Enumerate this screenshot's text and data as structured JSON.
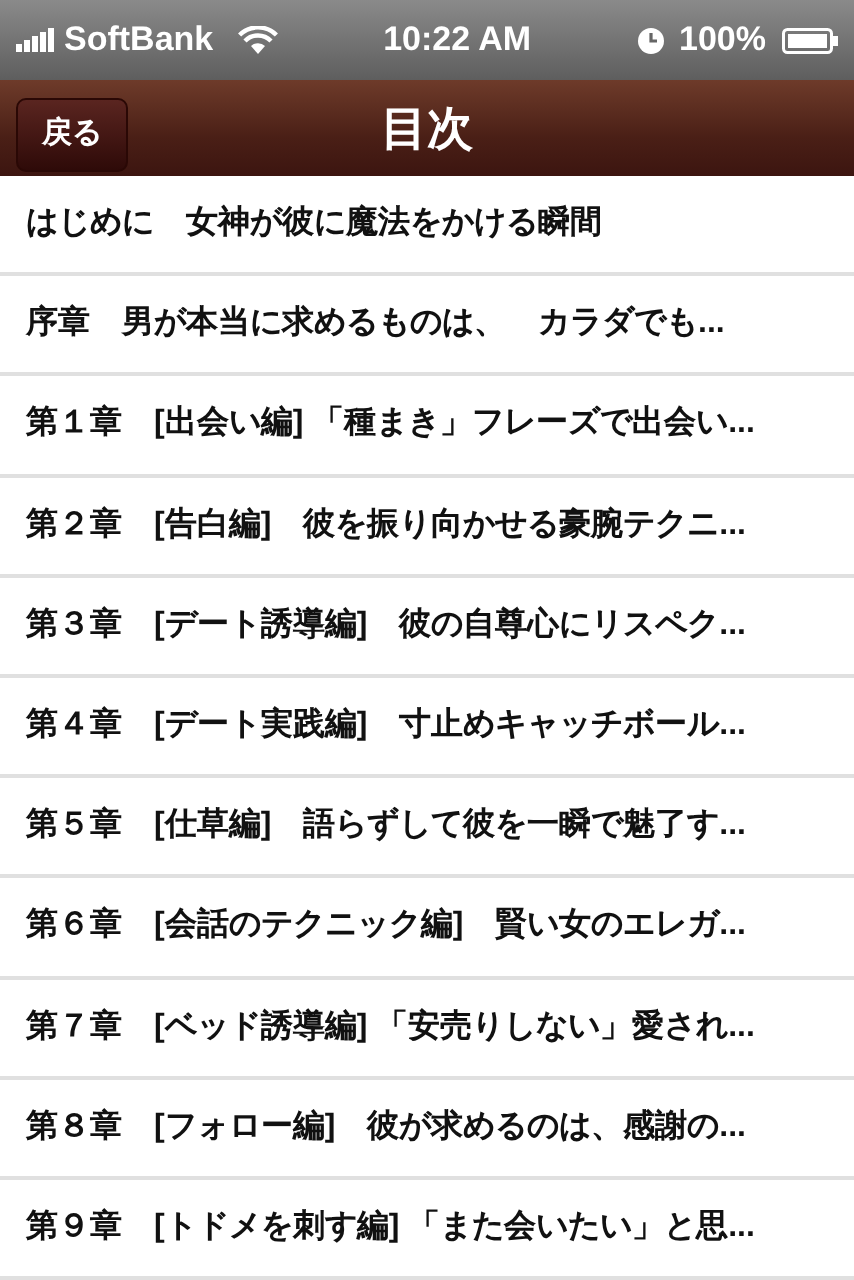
{
  "status_bar": {
    "carrier": "SoftBank",
    "time": "10:22 AM",
    "battery": "100%"
  },
  "nav_bar": {
    "back_button": "戻る",
    "title": "目次"
  },
  "items": [
    {
      "label": "はじめに　女神が彼に魔法をかける瞬間"
    },
    {
      "label": "序章　男が本当に求めるものは、　カラダでも..."
    },
    {
      "label": "第１章　[出会い編] 「種まき」フレーズで出会い..."
    },
    {
      "label": "第２章　[告白編]　彼を振り向かせる豪腕テクニ..."
    },
    {
      "label": "第３章　[デート誘導編]　彼の自尊心にリスペク..."
    },
    {
      "label": "第４章　[デート実践編]　寸止めキャッチボール..."
    },
    {
      "label": "第５章　[仕草編]　語らずして彼を一瞬で魅了す..."
    },
    {
      "label": "第６章　[会話のテクニック編]　賢い女のエレガ..."
    },
    {
      "label": "第７章　[ベッド誘導編] 「安売りしない」愛され..."
    },
    {
      "label": "第８章　[フォロー編]　彼が求めるのは、感謝の..."
    },
    {
      "label": "第９章　[トドメを刺す編] 「また会いたい」と思..."
    }
  ]
}
